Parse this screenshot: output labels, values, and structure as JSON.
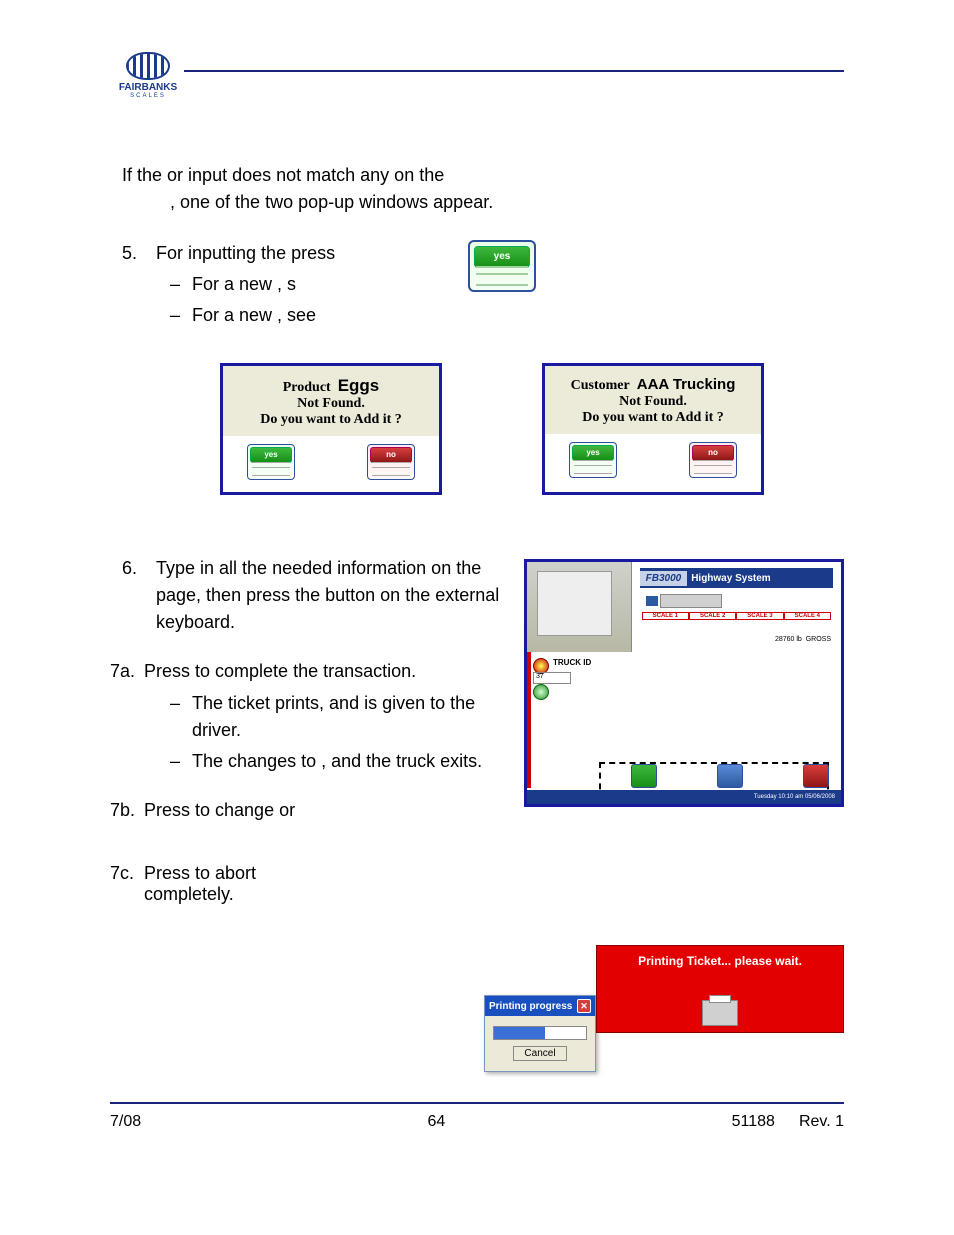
{
  "logo": {
    "name": "FAIRBANKS",
    "sub": "SCALES"
  },
  "intro": {
    "pre": "If the ",
    "or": " or ",
    "mid": " input does not match any on the ",
    "end": ", one of the two pop-up windows appear."
  },
  "step5": {
    "num": "5.",
    "text_a": "For inputting the ",
    "text_b": " press",
    "yes": "yes",
    "sub1a": "For a new ",
    "sub1b": ", s",
    "sub2a": "For a new ",
    "sub2b": ", see"
  },
  "popup_product": {
    "label": "Product",
    "value": "Eggs",
    "line2": "Not Found.",
    "line3": "Do you want to Add it ?",
    "yes": "yes",
    "no": "no"
  },
  "popup_customer": {
    "label": "Customer",
    "value": "AAA Trucking",
    "line2": "Not Found.",
    "line3": "Do you want to Add it ?",
    "yes": "yes",
    "no": "no"
  },
  "step6": {
    "num": "6.",
    "a": "Type in all the needed information on the ",
    "b": "page, then press the ",
    "c": " button on the external keyboard."
  },
  "step7a": {
    "num": "7a.",
    "a": "Press ",
    "b": " to complete the transaction.",
    "sub1": "The ticket prints, and is given to the driver.",
    "sub2a": "The ",
    "sub2b": " changes to ",
    "sub2c": ", and the truck exits."
  },
  "step7b": {
    "num": "7b.",
    "a": "Press ",
    "b": " to change ",
    "c": " or"
  },
  "step7c": {
    "num": "7c.",
    "a": "Press ",
    "b": " to abort ",
    "c": "completely."
  },
  "screenshot": {
    "fb": "FB3000",
    "hw": "Highway System",
    "truck_id_label": "TRUCK ID",
    "truck_id_value": "37",
    "gross_value": "28760 lb",
    "gross_label": "GROSS",
    "footer": "Tuesday   10:10 am   05/06/2008"
  },
  "printing_progress": {
    "title": "Printing progress",
    "cancel": "Cancel"
  },
  "printing_ticket": "Printing Ticket... please wait.",
  "footer": {
    "date": "7/08",
    "page": "64",
    "doc": "51188",
    "rev": "Rev. 1"
  }
}
